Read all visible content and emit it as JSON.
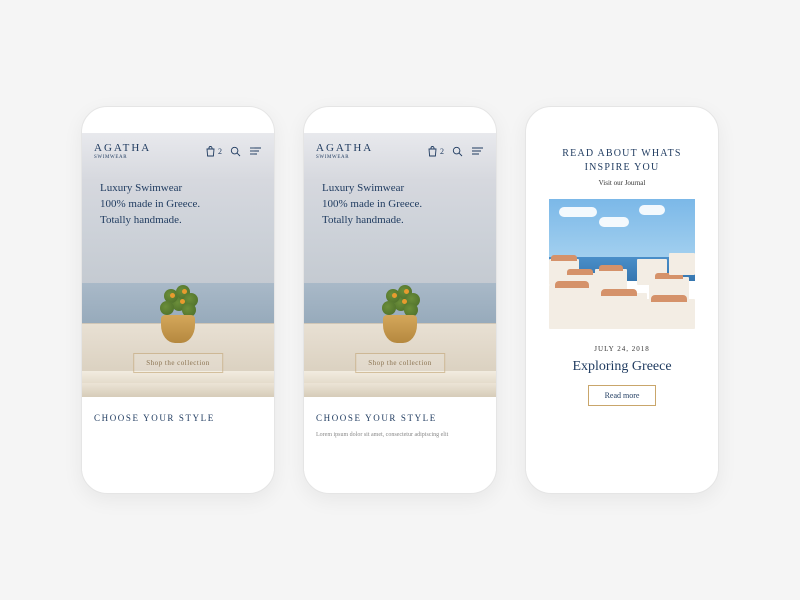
{
  "brand": {
    "name": "AGATHA",
    "subtitle": "SWIMWEAR"
  },
  "cart": {
    "count": "2"
  },
  "hero": {
    "line1": "Luxury Swimwear",
    "line2": "100% made in Greece.",
    "line3": "Totally handmade.",
    "cta": "Shop the collection"
  },
  "section": {
    "title": "CHOOSE YOUR STYLE",
    "lorem": "Lorem ipsum dolor sit amet, consectetur adipiscing elit"
  },
  "journal": {
    "heading_line1": "READ ABOUT WHATS",
    "heading_line2": "INSPIRE YOU",
    "subtitle": "Visit our Journal",
    "date": "JULY 24, 2018",
    "post_title": "Exploring Greece",
    "read_more": "Read more"
  }
}
